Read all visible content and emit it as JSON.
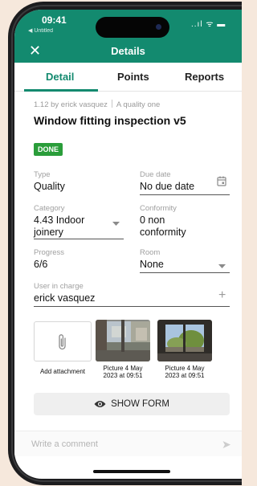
{
  "status": {
    "time": "09:41",
    "carrier": "◀ Untitled",
    "icons": "..ıl ᯤ ▬"
  },
  "header": {
    "close": "✕",
    "title": "Details"
  },
  "tabs": [
    {
      "label": "Detail"
    },
    {
      "label": "Points"
    },
    {
      "label": "Reports"
    }
  ],
  "breadcrumb": {
    "id_author": "1.12 by erick vasquez",
    "category": "A quality one"
  },
  "page_title": "Window fitting inspection v5",
  "status_badge": "DONE",
  "fields": {
    "type": {
      "label": "Type",
      "value": "Quality"
    },
    "due_date": {
      "label": "Due date",
      "value": "No due date"
    },
    "category": {
      "label": "Category",
      "value_line1": "4.43 Indoor",
      "value_line2": "joinery"
    },
    "conformity": {
      "label": "Conformity",
      "value_line1": "0 non",
      "value_line2": "conformity"
    },
    "progress": {
      "label": "Progress",
      "value": "6/6"
    },
    "room": {
      "label": "Room",
      "value": "None"
    },
    "user": {
      "label": "User in charge",
      "value": "erick vasquez"
    }
  },
  "attachments": {
    "add_label": "Add attachment",
    "pictures": [
      {
        "line1": "Picture 4 May",
        "line2": "2023 at 09:51"
      },
      {
        "line1": "Picture 4 May",
        "line2": "2023 at 09:51"
      }
    ]
  },
  "show_form": "SHOW FORM",
  "comment_placeholder": "Write a comment",
  "colors": {
    "accent": "#138a6f",
    "badge": "#2a9d3a",
    "background": "#f6e8dc"
  },
  "icons": [
    "close-icon",
    "calendar-icon",
    "dropdown-arrow-icon",
    "plus-icon",
    "paperclip-icon",
    "eye-icon",
    "send-icon"
  ]
}
